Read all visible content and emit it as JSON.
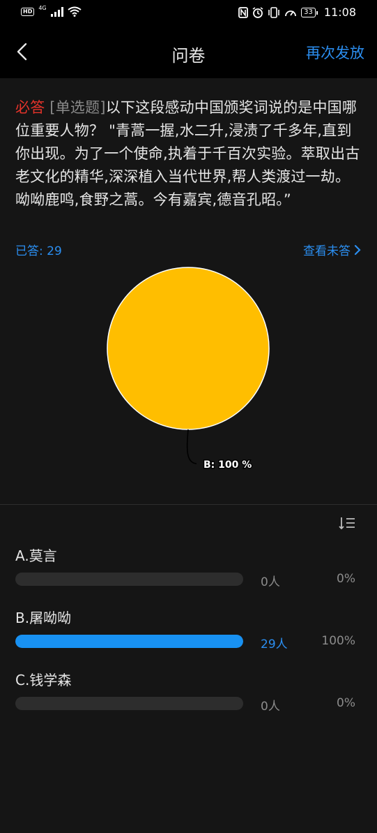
{
  "status_bar": {
    "left_indicators": [
      "HD",
      "4G"
    ],
    "time": "11:08",
    "battery": "33"
  },
  "nav": {
    "title": "问卷",
    "action": "再次发放"
  },
  "question": {
    "required_tag": "必答",
    "type_tag": "[单选题]",
    "text": "以下这段感动中国颁奖词说的是中国哪位重要人物？ \"青蒿一握,水二升,浸渍了千多年,直到你出现。为了一个使命,执着于千百次实验。萃取出古老文化的精华,深深植入当代世界,帮人类渡过一劫。呦呦鹿鸣,食野之蒿。今有嘉宾,德音孔昭。”"
  },
  "stats": {
    "answered_label": "已答: 29",
    "view_unanswered": "查看未答"
  },
  "chart_data": {
    "type": "pie",
    "slices": [
      {
        "label": "B",
        "value": 100,
        "color": "#FFBE00"
      }
    ],
    "slice_label": "B: 100 %"
  },
  "options": [
    {
      "label": "A.莫言",
      "count": "0人",
      "percent": "0%",
      "fraction": 0,
      "highlight": false
    },
    {
      "label": "B.屠呦呦",
      "count": "29人",
      "percent": "100%",
      "fraction": 1,
      "highlight": true
    },
    {
      "label": "C.钱学森",
      "count": "0人",
      "percent": "0%",
      "fraction": 0,
      "highlight": false
    }
  ],
  "colors": {
    "accent": "#2b8ef0",
    "required": "#e5332a",
    "pie": "#FFBE00"
  }
}
